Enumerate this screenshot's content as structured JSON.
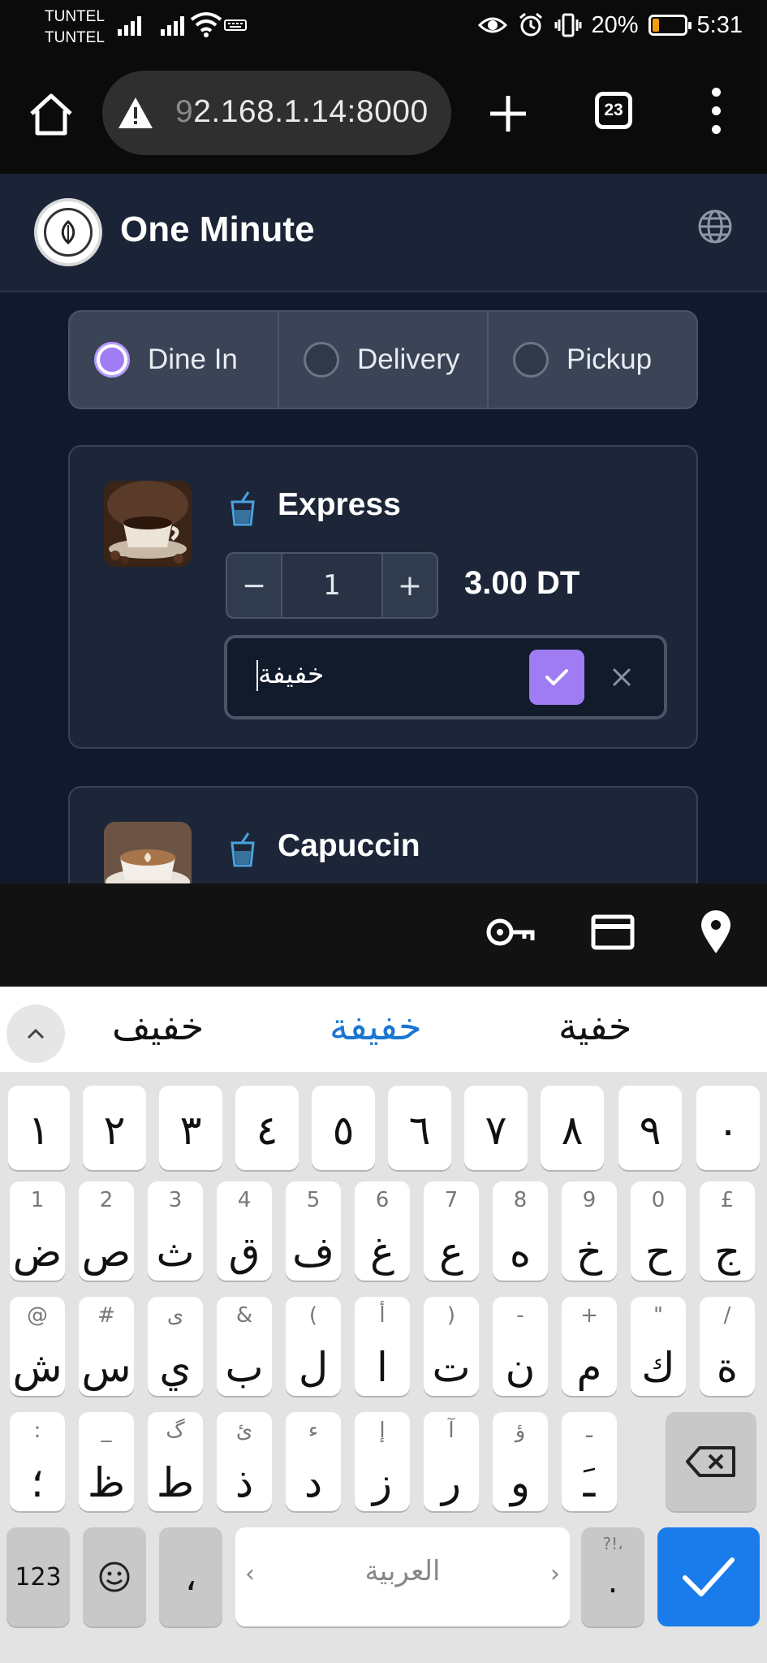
{
  "status_bar": {
    "carrier_1": "TUNTEL",
    "carrier_2": "TUNTEL",
    "battery": "20%",
    "battery_level": 0.2,
    "time": "5:31"
  },
  "browser": {
    "url_visible_prefix": "9",
    "url_rest": "2.168.1.14:8000",
    "tab_count": "23"
  },
  "app": {
    "brand": "One Minute",
    "order_types": [
      {
        "label": "Dine In",
        "selected": true
      },
      {
        "label": "Delivery",
        "selected": false
      },
      {
        "label": "Pickup",
        "selected": false
      }
    ],
    "items": [
      {
        "name": "Express",
        "quantity": "1",
        "price": "3.00 DT",
        "note": "خفيفة",
        "minus": "−",
        "plus": "+"
      },
      {
        "name": "Capuccin"
      }
    ]
  },
  "keyboard": {
    "suggestions": [
      "خفيف",
      "خفيفة",
      "خفية"
    ],
    "digits": [
      "١",
      "٢",
      "٣",
      "٤",
      "٥",
      "٦",
      "٧",
      "٨",
      "٩",
      "٠"
    ],
    "row1": [
      {
        "hint": "1",
        "key": "ض"
      },
      {
        "hint": "2",
        "key": "ص"
      },
      {
        "hint": "3",
        "key": "ث"
      },
      {
        "hint": "4",
        "key": "ق"
      },
      {
        "hint": "5",
        "key": "ف"
      },
      {
        "hint": "6",
        "key": "غ"
      },
      {
        "hint": "7",
        "key": "ع"
      },
      {
        "hint": "8",
        "key": "ه"
      },
      {
        "hint": "9",
        "key": "خ"
      },
      {
        "hint": "0",
        "key": "ح"
      },
      {
        "hint": "£",
        "key": "ج"
      }
    ],
    "row2": [
      {
        "hint": "@",
        "key": "ش"
      },
      {
        "hint": "#",
        "key": "س"
      },
      {
        "hint": "ى",
        "key": "ي"
      },
      {
        "hint": "&",
        "key": "ب"
      },
      {
        "hint": "(",
        "key": "ل"
      },
      {
        "hint": "أ",
        "key": "ا"
      },
      {
        "hint": ")",
        "key": "ت"
      },
      {
        "hint": "-",
        "key": "ن"
      },
      {
        "hint": "+",
        "key": "م"
      },
      {
        "hint": "\"",
        "key": "ك"
      },
      {
        "hint": "/",
        "key": "ة"
      }
    ],
    "row3": [
      {
        "hint": ":",
        "key": "؛"
      },
      {
        "hint": "_",
        "key": "ظ"
      },
      {
        "hint": "گ",
        "key": "ط"
      },
      {
        "hint": "ئ",
        "key": "ذ"
      },
      {
        "hint": "ء",
        "key": "د"
      },
      {
        "hint": "إ",
        "key": "ز"
      },
      {
        "hint": "آ",
        "key": "ر"
      },
      {
        "hint": "ؤ",
        "key": "و"
      },
      {
        "hint": "ـ",
        "key": "ـَ"
      }
    ],
    "key_123": "123",
    "comma": "،",
    "space_label": "العربية",
    "period_hint": "?!،",
    "period": "."
  }
}
